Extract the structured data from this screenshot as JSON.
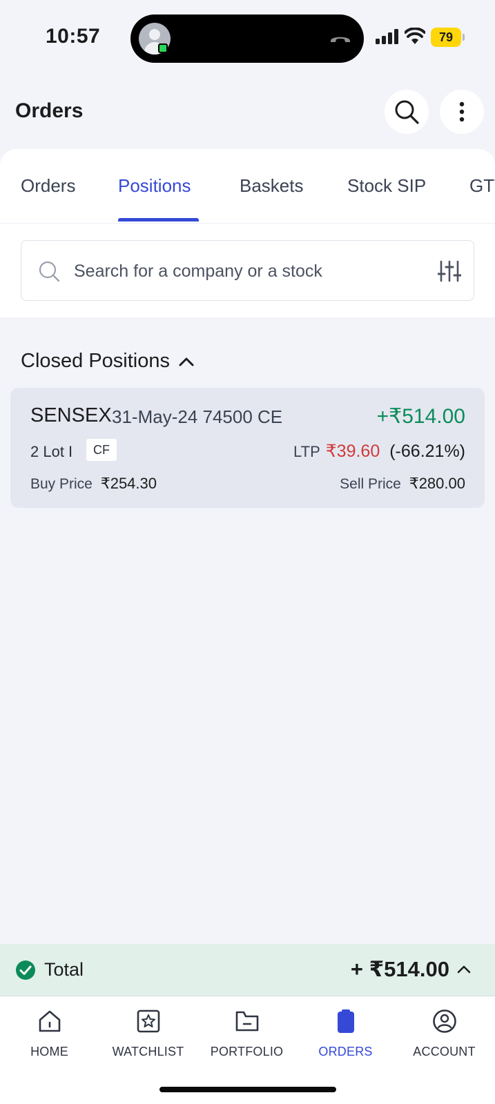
{
  "status_bar": {
    "time": "10:57",
    "battery": "79",
    "battery_color": "#ffd60a",
    "icons": [
      "caller-avatar",
      "hang-up-icon",
      "cellular-signal-icon",
      "wifi-icon",
      "battery-icon"
    ]
  },
  "header": {
    "title": "Orders",
    "icons": [
      "search-icon",
      "more-vertical-icon"
    ]
  },
  "tabs": [
    {
      "label": "Orders",
      "active": false
    },
    {
      "label": "Positions",
      "active": true
    },
    {
      "label": "Baskets",
      "active": false
    },
    {
      "label": "Stock SIP",
      "active": false
    },
    {
      "label": "GTT",
      "active": false
    }
  ],
  "search": {
    "placeholder": "Search for a company or a stock"
  },
  "closed_positions": {
    "heading": "Closed Positions",
    "items": [
      {
        "symbol": "SENSEX",
        "contract": "31-May-24 74500 CE",
        "pnl": "+₹514.00",
        "lot": "2 Lot I",
        "badge": "CF",
        "ltp_label": "LTP",
        "ltp": "₹39.60",
        "ltp_change": "(-66.21%)",
        "buy_label": "Buy Price",
        "buy_price": "₹254.30",
        "sell_label": "Sell Price",
        "sell_price": "₹280.00"
      }
    ]
  },
  "total": {
    "label": "Total",
    "value": "+ ₹514.00"
  },
  "bottom_nav": [
    {
      "label": "HOME",
      "icon": "home-icon",
      "active": false
    },
    {
      "label": "WATCHLIST",
      "icon": "star-icon",
      "active": false
    },
    {
      "label": "PORTFOLIO",
      "icon": "folder-icon",
      "active": false
    },
    {
      "label": "ORDERS",
      "icon": "clipboard-icon",
      "active": true
    },
    {
      "label": "ACCOUNT",
      "icon": "account-icon",
      "active": false
    }
  ],
  "colors": {
    "accent": "#3549d6",
    "profit": "#0c8b5a",
    "loss": "#d13b3b",
    "total_bar": "#e1f1ea"
  }
}
